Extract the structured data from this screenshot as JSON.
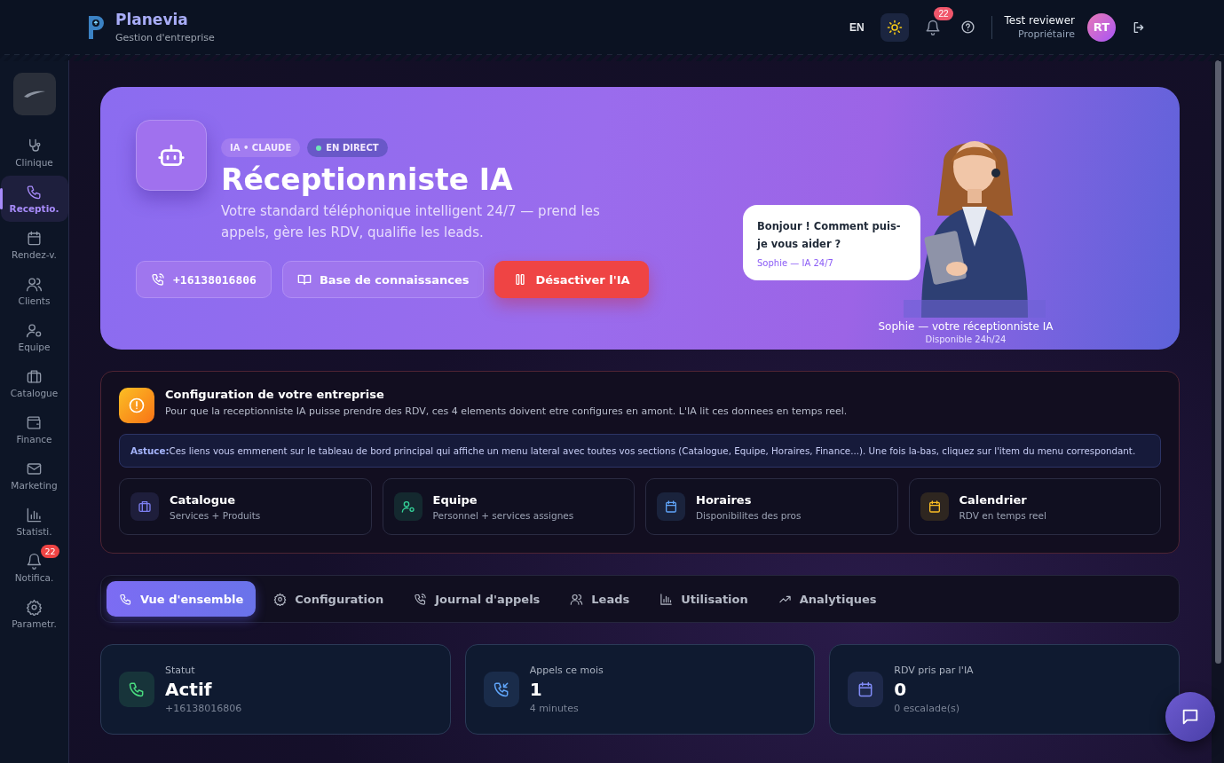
{
  "header": {
    "brand": "Planevia",
    "subtitle": "Gestion d'entreprise",
    "language": "EN",
    "notifications": "22",
    "user": {
      "name": "Test reviewer",
      "role": "Propriétaire",
      "initials": "RT"
    }
  },
  "sidebar": {
    "items": [
      {
        "label": "Clinique",
        "selected": false
      },
      {
        "label": "Receptio.",
        "selected": true
      },
      {
        "label": "Rendez-v.",
        "selected": false
      },
      {
        "label": "Clients",
        "selected": false
      },
      {
        "label": "Equipe",
        "selected": false
      },
      {
        "label": "Catalogue",
        "selected": false
      },
      {
        "label": "Finance",
        "selected": false
      },
      {
        "label": "Marketing",
        "selected": false
      },
      {
        "label": "Statisti.",
        "selected": false
      },
      {
        "label": "Notifica.",
        "selected": false,
        "badge": "22"
      },
      {
        "label": "Parametr.",
        "selected": false
      }
    ]
  },
  "hero": {
    "tags": [
      {
        "label": "IA • CLAUDE",
        "live": false
      },
      {
        "label": "EN DIRECT",
        "live": true
      }
    ],
    "title": "Réceptionniste IA",
    "description": "Votre standard téléphonique intelligent 24/7 — prend les appels, gère les RDV, qualifie les leads.",
    "buttons": [
      {
        "label": "+16138016806",
        "kind": "phone"
      },
      {
        "label": "Base de connaissances",
        "kind": "book"
      },
      {
        "label": "Désactiver l'IA",
        "kind": "danger"
      }
    ],
    "bubble": {
      "message": "Bonjour ! Comment puis-je vous aider ?",
      "signature": "Sophie — IA 24/7"
    },
    "caption": "Sophie — votre réceptionniste IA",
    "availability": "Disponible 24h/24"
  },
  "setup": {
    "title": "Configuration de votre entreprise",
    "description": "Pour que la receptionniste IA puisse prendre des RDV, ces 4 elements doivent etre configures en amont. L'IA lit ces donnees en temps reel.",
    "tip": "**Astuce:**Ces liens vous emmenent sur le tableau de bord principal qui affiche un menu lateral avec toutes vos sections (Catalogue, Equipe, Horaires, Finance...). Une fois la-bas, cliquez sur l'item du menu correspondant.",
    "cards": [
      {
        "title": "Catalogue",
        "subtitle": "Services + Produits",
        "color": "#7c7ff0"
      },
      {
        "title": "Equipe",
        "subtitle": "Personnel + services assignes",
        "color": "#34d399"
      },
      {
        "title": "Horaires",
        "subtitle": "Disponibilites des pros",
        "color": "#60a5fa"
      },
      {
        "title": "Calendrier",
        "subtitle": "RDV en temps reel",
        "color": "#fbbf24"
      }
    ]
  },
  "tabs": [
    {
      "label": "Vue d'ensemble",
      "selected": true
    },
    {
      "label": "Configuration",
      "selected": false
    },
    {
      "label": "Journal d'appels",
      "selected": false
    },
    {
      "label": "Leads",
      "selected": false
    },
    {
      "label": "Utilisation",
      "selected": false
    },
    {
      "label": "Analytiques",
      "selected": false
    }
  ],
  "stats": [
    {
      "label": "Statut",
      "value": "Actif",
      "detail": "+16138016806",
      "color": "#4ade80"
    },
    {
      "label": "Appels ce mois",
      "value": "1",
      "detail": "4 minutes",
      "color": "#60a5fa"
    },
    {
      "label": "RDV pris par l'IA",
      "value": "0",
      "detail": "0 escalade(s)",
      "color": "#818cf8"
    }
  ]
}
